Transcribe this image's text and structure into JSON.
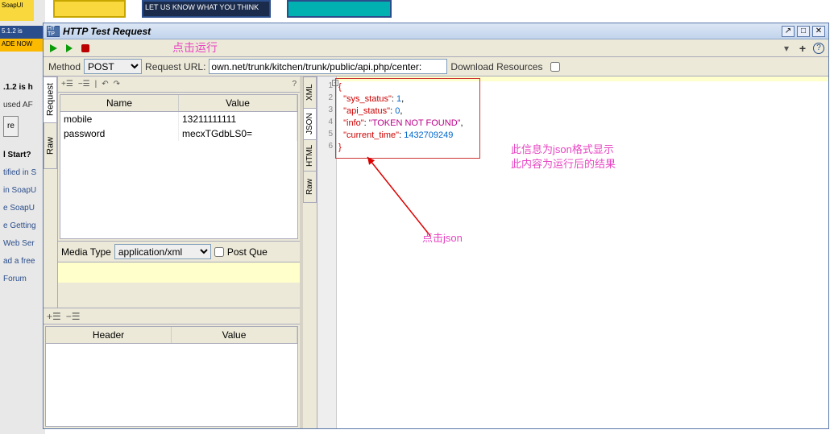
{
  "background": {
    "banner_text": "SoapUI",
    "version_strip": "5.1.2 is",
    "ade_text": "ADE NOW",
    "side_heading1": ".1.2 is h",
    "side_text1": "used AF",
    "side_heading2": "l Start?",
    "links": [
      "tified in S",
      "in SoapU",
      "e SoapU",
      "e Getting",
      "Web Ser",
      "ad a free",
      "Forum"
    ],
    "btn_label": "re"
  },
  "dialog": {
    "icon_text": "HT\nTP",
    "title": "HTTP Test Request",
    "win": {
      "pop": "↗",
      "max": "□",
      "close": "✕"
    }
  },
  "toolbar": {
    "annot_run": "点击运行"
  },
  "urlbar": {
    "method_label": "Method",
    "method_value": "POST",
    "request_url_label": "Request URL:",
    "url_value": "own.net/trunk/kitchen/trunk/public/api.php/center:",
    "download_label": "Download Resources"
  },
  "request": {
    "side_tabs": {
      "request": "Request",
      "raw": "Raw"
    },
    "table": {
      "col_name": "Name",
      "col_value": "Value",
      "rows": [
        {
          "name": "mobile",
          "value": "13211111111"
        },
        {
          "name": "password",
          "value": "mecxTGdbLS0="
        }
      ]
    },
    "media_label": "Media Type",
    "media_value": "application/xml",
    "post_query_label": "Post Que",
    "header_table": {
      "col_header": "Header",
      "col_value": "Value"
    }
  },
  "response": {
    "tabs": {
      "xml": "XML",
      "json": "JSON",
      "html": "HTML",
      "raw": "Raw"
    },
    "gutter": [
      "1",
      "2",
      "3",
      "4",
      "5",
      "6"
    ],
    "json_lines": [
      {
        "brace": "{"
      },
      {
        "key": "\"sys_status\"",
        "sep": ": ",
        "val": "1",
        "comma": ","
      },
      {
        "key": "\"api_status\"",
        "sep": ": ",
        "val": "0",
        "comma": ","
      },
      {
        "key": "\"info\"",
        "sep": ": ",
        "val": "\"TOKEN NOT FOUND\"",
        "comma": ","
      },
      {
        "key": "\"current_time\"",
        "sep": ": ",
        "val": "1432709249"
      },
      {
        "brace": "}"
      }
    ],
    "annot_json": "点击json",
    "annot_info_l1": "此信息为json格式显示",
    "annot_info_l2": "此内容为运行后的结果"
  }
}
